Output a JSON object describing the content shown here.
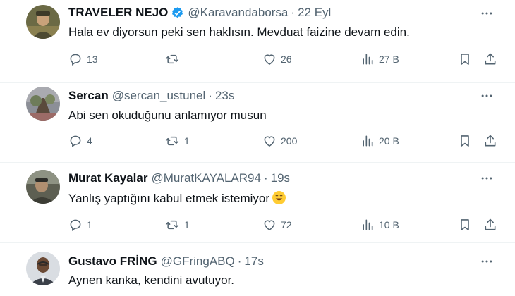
{
  "tweets": [
    {
      "name": "TRAVELER NEJO",
      "verified": true,
      "handle": "@Karavandaborsa",
      "separator": "·",
      "time": "22 Eyl",
      "text": "Hala ev diyorsun peki sen haklısın. Mevduat faizine devam edin.",
      "replies": "13",
      "retweets": "",
      "likes": "26",
      "views": "27 B"
    },
    {
      "name": "Sercan",
      "verified": false,
      "handle": "@sercan_ustunel",
      "separator": "·",
      "time": "23s",
      "text": "Abi sen okuduğunu anlamıyor musun",
      "replies": "4",
      "retweets": "1",
      "likes": "200",
      "views": "20 B"
    },
    {
      "name": "Murat Kayalar",
      "verified": false,
      "handle": "@MuratKAYALAR94",
      "separator": "·",
      "time": "19s",
      "text": "Yanlış yaptığını kabul etmek istemiyor",
      "emoji": "joy",
      "replies": "1",
      "retweets": "1",
      "likes": "72",
      "views": "10 B"
    },
    {
      "name": "Gustavo FRİNG",
      "verified": false,
      "handle": "@GFringABQ",
      "separator": "·",
      "time": "17s",
      "text": "Aynen kanka, kendini avutuyor."
    }
  ],
  "icons": {
    "reply": "reply-icon",
    "retweet": "retweet-icon",
    "like": "like-icon",
    "views": "views-icon",
    "bookmark": "bookmark-icon",
    "share": "share-icon",
    "more": "more-icon",
    "verified": "verified-icon"
  },
  "colors": {
    "text": "#0f1419",
    "secondary": "#536471",
    "verified": "#1d9bf0",
    "divider": "#eff3f4"
  }
}
